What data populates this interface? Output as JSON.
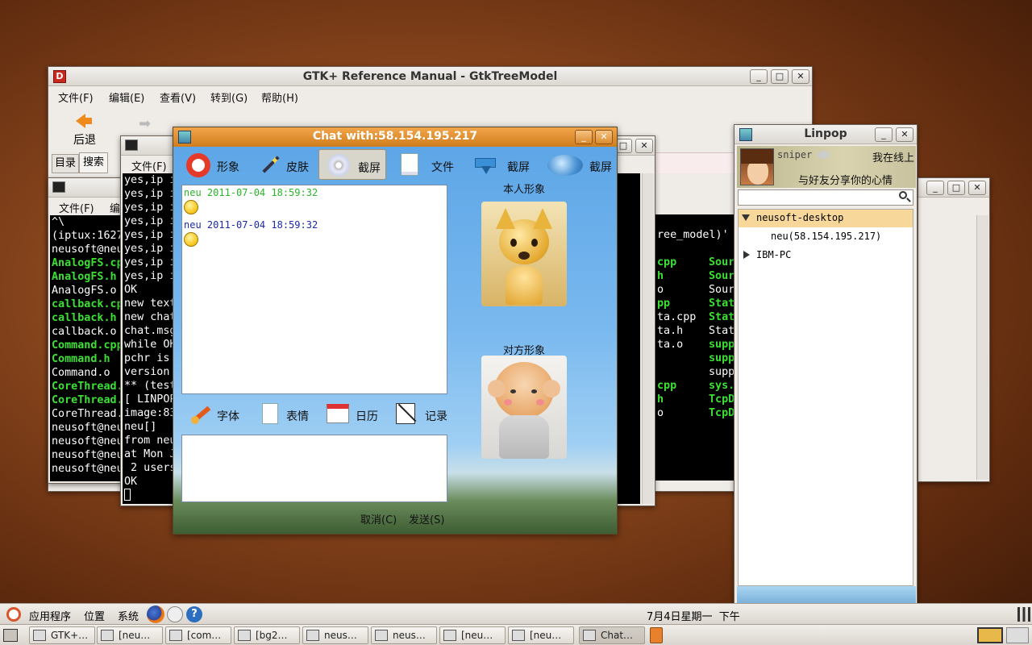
{
  "gtk_window": {
    "title": "GTK+ Reference Manual - GtkTreeModel",
    "menu": [
      "文件(F)",
      "编辑(E)",
      "查看(V)",
      "转到(G)",
      "帮助(H)"
    ],
    "back_label": "后退",
    "side_tabs": [
      "目录",
      "搜索"
    ]
  },
  "terminal_left": {
    "menu": [
      "文件(F)",
      "编"
    ],
    "lines": [
      {
        "text": "^\\",
        "green": false
      },
      {
        "text": "(iptux:1627",
        "green": false
      },
      {
        "text": "neusoft@neu",
        "green": false
      },
      {
        "text": "AnalogFS.cp",
        "green": true
      },
      {
        "text": "AnalogFS.h",
        "green": true
      },
      {
        "text": "AnalogFS.o",
        "green": false
      },
      {
        "text": "callback.cp",
        "green": true
      },
      {
        "text": "callback.h",
        "green": true
      },
      {
        "text": "callback.o",
        "green": false
      },
      {
        "text": "Command.cpp",
        "green": true
      },
      {
        "text": "Command.h",
        "green": true
      },
      {
        "text": "Command.o",
        "green": false
      },
      {
        "text": "CoreThread.",
        "green": true
      },
      {
        "text": "CoreThread.",
        "green": true
      },
      {
        "text": "CoreThread.",
        "green": false
      },
      {
        "text": "neusoft@neu",
        "green": false
      },
      {
        "text": "neusoft@neu",
        "green": false
      },
      {
        "text": "neusoft@neu",
        "green": false
      },
      {
        "text": "neusoft@neu",
        "green": false
      }
    ]
  },
  "terminal_mid": {
    "menu": [
      "文件(F)"
    ],
    "lines": [
      "yes,ip i",
      "yes,ip i",
      "yes,ip i",
      "yes,ip i",
      "yes,ip i",
      "yes,ip i",
      "yes,ip i",
      "yes,ip i",
      "OK",
      "new text",
      "new chat",
      "chat.msg",
      "while OK",
      "pchr is",
      "version",
      "** (test",
      "[ LINPOP",
      "image:83",
      "neu[]",
      "from neu",
      "at Mon J",
      " 2 users",
      "OK"
    ]
  },
  "terminal_right": {
    "lines": [
      {
        "a": "ree_model)'",
        "b": "",
        "bg": false
      },
      {
        "a": "",
        "b": "",
        "bg": false
      },
      {
        "a": "cpp",
        "b": "Sour",
        "ag": true,
        "bg": true
      },
      {
        "a": "h",
        "b": "Sour",
        "ag": true,
        "bg": true
      },
      {
        "a": "o",
        "b": "Sour",
        "ag": false,
        "bg": false
      },
      {
        "a": "pp",
        "b": "Stat",
        "ag": true,
        "bg": true
      },
      {
        "a": "ta.cpp",
        "b": "Stat",
        "ag": false,
        "bg": true
      },
      {
        "a": "ta.h",
        "b": "Stat",
        "ag": false,
        "bg": false
      },
      {
        "a": "ta.o",
        "b": "supp",
        "ag": false,
        "bg": true
      },
      {
        "a": "",
        "b": "supp",
        "ag": false,
        "bg": true
      },
      {
        "a": "",
        "b": "supp",
        "ag": false,
        "bg": false
      },
      {
        "a": "cpp",
        "b": "sys.",
        "ag": true,
        "bg": true
      },
      {
        "a": "h",
        "b": "TcpD",
        "ag": true,
        "bg": true
      },
      {
        "a": "o",
        "b": "TcpD",
        "ag": false,
        "bg": true
      }
    ]
  },
  "chat_window": {
    "title": "Chat with:58.154.195.217",
    "toolbar": [
      "形象",
      "皮肤",
      "截屏",
      "文件",
      "截屏",
      "截屏"
    ],
    "messages": [
      {
        "sender": "neu",
        "time": "2011-07-04 18:59:32",
        "color": "#2ab52a"
      },
      {
        "sender": "neu",
        "time": "2011-07-04 18:59:32",
        "color": "#1c2aa8"
      }
    ],
    "self_avatar_label": "本人形象",
    "peer_avatar_label": "对方形象",
    "tools": [
      "字体",
      "表情",
      "日历",
      "记录"
    ],
    "cancel_button": "取消(C)",
    "send_button": "发送(S)"
  },
  "linpop": {
    "title": "Linpop",
    "username": "sniper",
    "status": "我在线上",
    "signature": "与好友分享你的心情",
    "search_placeholder": "",
    "groups": [
      {
        "name": "neusoft-desktop",
        "expanded": true,
        "members": [
          "neu(58.154.195.217)"
        ]
      },
      {
        "name": "IBM-PC",
        "expanded": false,
        "members": []
      }
    ]
  },
  "top_panel": {
    "menus": [
      "应用程序",
      "位置",
      "系统"
    ],
    "clock": "7月4日星期一  下午"
  },
  "taskbar": {
    "items": [
      "GTK+…",
      "[neu…",
      "[com…",
      "[bg2…",
      "neus…",
      "neus…",
      "[neu…",
      "[neu…",
      "Chat…"
    ],
    "active_index": 8
  }
}
